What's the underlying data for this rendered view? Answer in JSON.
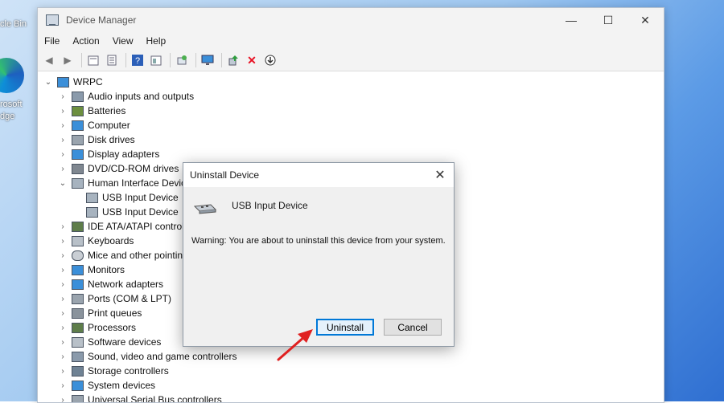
{
  "desktop": {
    "recycle_label": "cle Bin",
    "edge_label_1": "rosoft",
    "edge_label_2": "dge"
  },
  "window": {
    "title": "Device Manager",
    "controls": {
      "minimize": "—",
      "maximize": "☐",
      "close": "✕"
    }
  },
  "menu": [
    "File",
    "Action",
    "View",
    "Help"
  ],
  "tree": {
    "root": "WRPC",
    "items": [
      {
        "label": "Audio inputs and outputs",
        "expanded": false
      },
      {
        "label": "Batteries",
        "expanded": false
      },
      {
        "label": "Computer",
        "expanded": false
      },
      {
        "label": "Disk drives",
        "expanded": false
      },
      {
        "label": "Display adapters",
        "expanded": false
      },
      {
        "label": "DVD/CD-ROM drives",
        "expanded": false
      },
      {
        "label": "Human Interface Devic",
        "expanded": true
      },
      {
        "label": "USB Input Device",
        "child": true
      },
      {
        "label": "USB Input Device",
        "child": true
      },
      {
        "label": "IDE ATA/ATAPI controll",
        "expanded": false
      },
      {
        "label": "Keyboards",
        "expanded": false
      },
      {
        "label": "Mice and other pointin",
        "expanded": false
      },
      {
        "label": "Monitors",
        "expanded": false
      },
      {
        "label": "Network adapters",
        "expanded": false
      },
      {
        "label": "Ports (COM & LPT)",
        "expanded": false
      },
      {
        "label": "Print queues",
        "expanded": false
      },
      {
        "label": "Processors",
        "expanded": false
      },
      {
        "label": "Software devices",
        "expanded": false
      },
      {
        "label": "Sound, video and game controllers",
        "expanded": false
      },
      {
        "label": "Storage controllers",
        "expanded": false
      },
      {
        "label": "System devices",
        "expanded": false
      },
      {
        "label": "Universal Serial Bus controllers",
        "expanded": false
      }
    ]
  },
  "dialog": {
    "title": "Uninstall Device",
    "device_name": "USB Input Device",
    "warning": "Warning: You are about to uninstall this device from your system.",
    "uninstall_label": "Uninstall",
    "cancel_label": "Cancel",
    "close": "✕"
  },
  "colors": {
    "accent": "#0078d7",
    "arrow": "#e02020",
    "delete_icon": "#e81123"
  }
}
